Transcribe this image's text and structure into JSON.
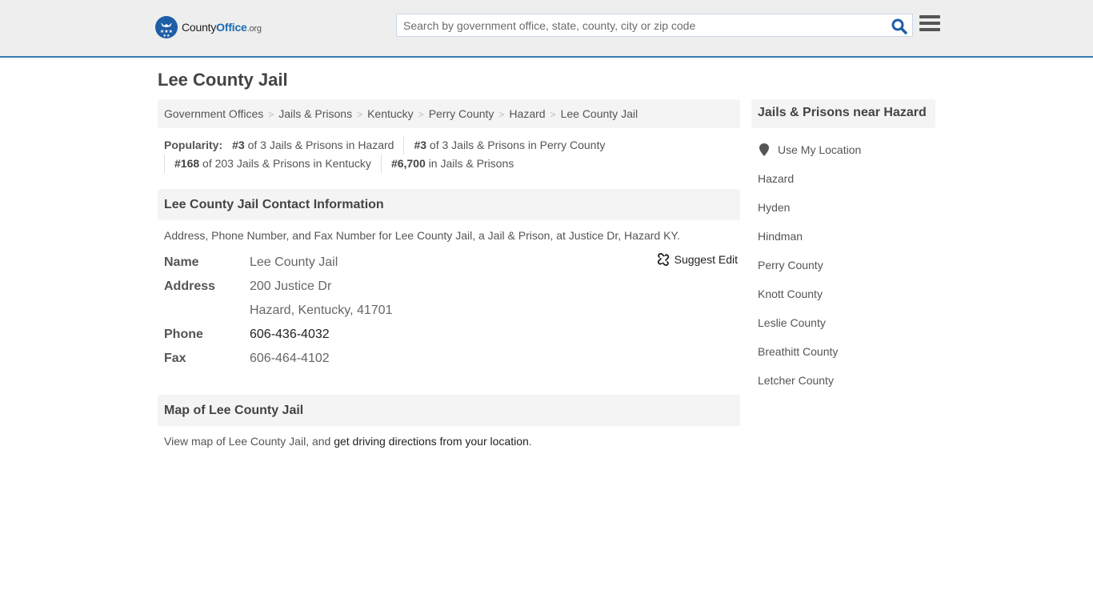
{
  "header": {
    "logo": {
      "brand_left": "County",
      "brand_right": "Office",
      "tld": ".org"
    },
    "search": {
      "placeholder": "Search by government office, state, county, city or zip code",
      "value": ""
    },
    "colors": {
      "accent": "#1d6bb5",
      "border": "#3a7cb0"
    }
  },
  "page": {
    "title": "Lee County Jail",
    "breadcrumb": [
      {
        "label": "Government Offices"
      },
      {
        "label": "Jails & Prisons"
      },
      {
        "label": "Kentucky"
      },
      {
        "label": "Perry County"
      },
      {
        "label": "Hazard"
      },
      {
        "label": "Lee County Jail"
      }
    ],
    "popularity": {
      "label": "Popularity:",
      "items": [
        {
          "rank": "#3",
          "text": "of 3 Jails & Prisons in Hazard"
        },
        {
          "rank": "#3",
          "text": "of 3 Jails & Prisons in Perry County"
        },
        {
          "rank": "#168",
          "text": "of 203 Jails & Prisons in Kentucky"
        },
        {
          "rank": "#6,700",
          "text": "in Jails & Prisons"
        }
      ]
    }
  },
  "contact": {
    "heading": "Lee County Jail Contact Information",
    "description": "Address, Phone Number, and Fax Number for Lee County Jail, a Jail & Prison, at Justice Dr, Hazard KY.",
    "suggest_edit": "Suggest Edit",
    "fields": {
      "name_label": "Name",
      "name": "Lee County Jail",
      "address_label": "Address",
      "address_line1": "200 Justice Dr",
      "address_line2": "Hazard, Kentucky, 41701",
      "phone_label": "Phone",
      "phone": "606-436-4032",
      "fax_label": "Fax",
      "fax": "606-464-4102"
    }
  },
  "map": {
    "heading": "Map of Lee County Jail",
    "text_prefix": "View map of Lee County Jail, and ",
    "link": "get driving directions from your location",
    "text_suffix": "."
  },
  "sidebar": {
    "heading": "Jails & Prisons near Hazard",
    "use_location": "Use My Location",
    "links": [
      "Hazard",
      "Hyden",
      "Hindman",
      "Perry County",
      "Knott County",
      "Leslie County",
      "Breathitt County",
      "Letcher County"
    ]
  }
}
